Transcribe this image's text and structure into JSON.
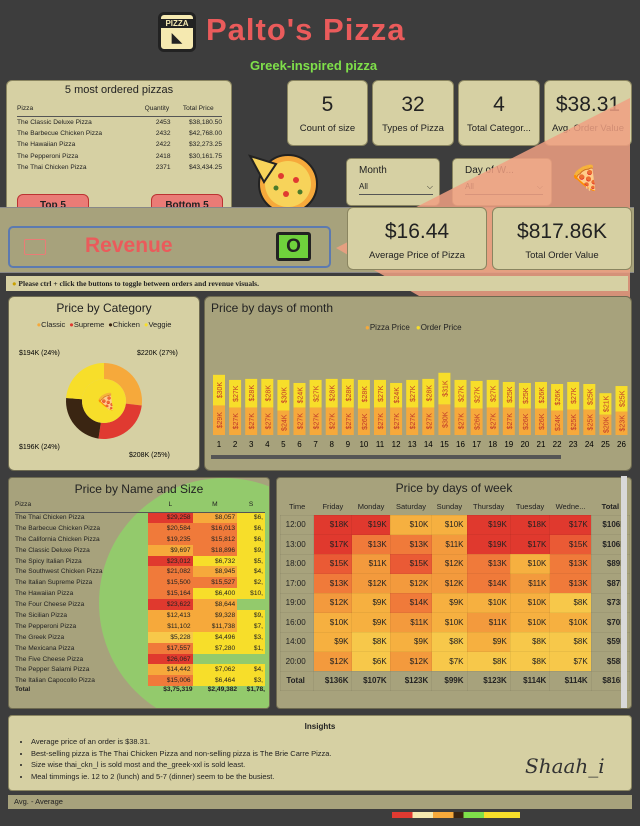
{
  "header": {
    "logo_text": "PIZZA",
    "title": "Palto's Pizza",
    "subtitle": "Greek-inspired pizza"
  },
  "top5": {
    "title": "5 most ordered pizzas",
    "col_pizza": "Pizza",
    "col_qty": "Quantity",
    "col_total": "Total Price",
    "rows": [
      {
        "name": "The Classic Deluxe Pizza",
        "qty": "2453",
        "total": "$38,180.50"
      },
      {
        "name": "The Barbecue Chicken Pizza",
        "qty": "2432",
        "total": "$42,768.00"
      },
      {
        "name": "The Hawaiian Pizza",
        "qty": "2422",
        "total": "$32,273.25"
      },
      {
        "name": "The Pepperoni Pizza",
        "qty": "2418",
        "total": "$30,161.75"
      },
      {
        "name": "The Thai Chicken Pizza",
        "qty": "2371",
        "total": "$43,434.25"
      }
    ],
    "btn_top": "Top 5",
    "btn_bottom": "Bottom 5"
  },
  "kpis": {
    "count_size": {
      "value": "5",
      "label": "Count of size"
    },
    "types": {
      "value": "32",
      "label": "Types of Pizza"
    },
    "categories": {
      "value": "4",
      "label": "Total Categor..."
    },
    "avg_order": {
      "value": "$38.31",
      "label": "Avg. Order Value"
    },
    "avg_price": {
      "value": "$16.44",
      "label": "Average Price of Pizza"
    },
    "total_order": {
      "value": "$817.86K",
      "label": "Total Order Value"
    }
  },
  "filters": {
    "month_label": "Month",
    "month_value": "All",
    "dow_label": "Day of W...",
    "dow_value": "All"
  },
  "toggle": {
    "label": "Revenue",
    "switch": "O"
  },
  "hint": "Please ctrl + click the buttons to toggle between orders and revenue visuals.",
  "colors": {
    "classic": "#f6a93b",
    "supreme": "#e03a31",
    "chicken": "#3a2512",
    "veggie": "#f7de2a",
    "bar_price": "#f6a93b",
    "bar_order": "#f7de2a",
    "accent_red": "#ea5b5b",
    "title_green": "#7fe04a"
  },
  "category_chart": {
    "title": "Price by Category",
    "legend": [
      "Classic",
      "Supreme",
      "Chicken",
      "Veggie"
    ],
    "labels": [
      "$194K (24%)",
      "$220K (27%)",
      "$196K (24%)",
      "$208K (25%)"
    ],
    "chart_data": {
      "type": "pie",
      "categories": [
        "Classic",
        "Supreme",
        "Chicken",
        "Veggie"
      ],
      "values": [
        220,
        208,
        196,
        194
      ]
    }
  },
  "day_month_chart": {
    "title": "Price by days of month",
    "legend": [
      "Pizza Price",
      "Order Price"
    ],
    "chart_data": {
      "type": "bar",
      "categories": [
        "1",
        "2",
        "3",
        "4",
        "5",
        "6",
        "7",
        "8",
        "9",
        "10",
        "11",
        "12",
        "13",
        "14",
        "15",
        "16",
        "17",
        "18",
        "19",
        "20",
        "21",
        "22",
        "23",
        "24",
        "25",
        "26"
      ],
      "series": [
        {
          "name": "Pizza Price",
          "values": [
            29,
            27,
            27,
            27,
            24,
            27,
            27,
            27,
            27,
            26,
            27,
            27,
            27,
            27,
            30,
            27,
            26,
            27,
            27,
            26,
            26,
            24,
            25,
            25,
            20,
            23
          ]
        },
        {
          "name": "Order Price",
          "values": [
            30,
            27,
            28,
            28,
            30,
            24,
            27,
            28,
            28,
            28,
            27,
            24,
            27,
            28,
            31,
            27,
            27,
            27,
            25,
            25,
            26,
            26,
            27,
            25,
            21,
            25
          ]
        }
      ],
      "top_labels": [
        "$30K",
        "$27K",
        "$28K",
        "$28K",
        "$30K",
        "$24K",
        "$27K",
        "$28K",
        "$28K",
        "$28K",
        "$27K",
        "$24K",
        "$27K",
        "$28K",
        "$31K",
        "$27K",
        "$27K",
        "$27K",
        "$25K",
        "$25K",
        "$26K",
        "$26K",
        "$27K",
        "$25K",
        "$21K",
        "$25K"
      ],
      "bottom_labels": [
        "$29K",
        "$27K",
        "$27K",
        "$27K",
        "$24K",
        "$27K",
        "$27K",
        "$27K",
        "$27K",
        "$26K",
        "$27K",
        "$27K",
        "$27K",
        "$27K",
        "$30K",
        "$27K",
        "$26K",
        "$27K",
        "$27K",
        "$26K",
        "$26K",
        "$24K",
        "$25K",
        "$25K",
        "$20K",
        "$23K"
      ]
    }
  },
  "name_size": {
    "title": "Price by Name and Size",
    "cols": [
      "Pizza",
      "L",
      "M",
      "S"
    ],
    "rows": [
      [
        "The Thai Chicken Pizza",
        "$29,258",
        "$8,057",
        "$6,"
      ],
      [
        "The Barbecue Chicken Pizza",
        "$20,584",
        "$16,013",
        "$6,"
      ],
      [
        "The California Chicken Pizza",
        "$19,235",
        "$15,812",
        "$6,"
      ],
      [
        "The Classic Deluxe Pizza",
        "$9,697",
        "$18,896",
        "$9,"
      ],
      [
        "The Spicy Italian Pizza",
        "$23,012",
        "$6,732",
        "$5,"
      ],
      [
        "The Southwest Chicken Pizza",
        "$21,082",
        "$8,945",
        "$4,"
      ],
      [
        "The Italian Supreme Pizza",
        "$15,500",
        "$15,527",
        "$2,"
      ],
      [
        "The Hawaiian Pizza",
        "$15,164",
        "$6,400",
        "$10,"
      ],
      [
        "The Four Cheese Pizza",
        "$23,622",
        "$8,644",
        ""
      ],
      [
        "The Sicilian Pizza",
        "$12,413",
        "$9,328",
        "$9,"
      ],
      [
        "The Pepperoni Pizza",
        "$11,102",
        "$11,738",
        "$7,"
      ],
      [
        "The Greek Pizza",
        "$5,228",
        "$4,496",
        "$3,"
      ],
      [
        "The Mexicana Pizza",
        "$17,557",
        "$7,280",
        "$1,"
      ],
      [
        "The Five Cheese Pizza",
        "$26,067",
        "",
        ""
      ],
      [
        "The Pepper Salami Pizza",
        "$14,442",
        "$7,062",
        "$4,"
      ],
      [
        "The Italian Capocollo Pizza",
        "$15,006",
        "$6,464",
        "$3,"
      ]
    ],
    "total": [
      "Total",
      "$3,75,319",
      "$2,49,382",
      "$1,78,"
    ]
  },
  "heatmap": {
    "title": "Price by days of week",
    "cols": [
      "Time",
      "Friday",
      "Monday",
      "Saturday",
      "Sunday",
      "Thursday",
      "Tuesday",
      "Wedne...",
      "Total"
    ],
    "rows": [
      [
        "12:00",
        "$18K",
        "$19K",
        "$10K",
        "$10K",
        "$19K",
        "$18K",
        "$17K",
        "$106K"
      ],
      [
        "13:00",
        "$17K",
        "$13K",
        "$13K",
        "$11K",
        "$19K",
        "$17K",
        "$15K",
        "$106K"
      ],
      [
        "18:00",
        "$15K",
        "$11K",
        "$15K",
        "$12K",
        "$13K",
        "$10K",
        "$13K",
        "$89K"
      ],
      [
        "17:00",
        "$13K",
        "$12K",
        "$12K",
        "$12K",
        "$14K",
        "$11K",
        "$13K",
        "$87K"
      ],
      [
        "19:00",
        "$12K",
        "$9K",
        "$14K",
        "$9K",
        "$10K",
        "$10K",
        "$8K",
        "$73K"
      ],
      [
        "16:00",
        "$10K",
        "$9K",
        "$11K",
        "$10K",
        "$11K",
        "$10K",
        "$10K",
        "$70K"
      ],
      [
        "14:00",
        "$9K",
        "$8K",
        "$9K",
        "$8K",
        "$9K",
        "$8K",
        "$8K",
        "$59K"
      ],
      [
        "20:00",
        "$12K",
        "$6K",
        "$12K",
        "$7K",
        "$8K",
        "$8K",
        "$7K",
        "$58K"
      ]
    ],
    "total": [
      "Total",
      "$136K",
      "$107K",
      "$123K",
      "$99K",
      "$123K",
      "$114K",
      "$114K",
      "$816K"
    ]
  },
  "insights": {
    "title": "Insights",
    "items": [
      "Average price of an order is $38.31.",
      "Best-selling pizza is The Thai Chicken Pizza and non-selling pizza is The Brie Carre Pizza.",
      "Size wise thai_ckn_l is sold most and the_greek-xxl is sold least.",
      "Meal timmings ie. 12 to 2 (lunch) and 5-7 (dinner) seem to be the busiest."
    ],
    "signature": "Shaah_i"
  },
  "footer": {
    "text": "Avg. - Average"
  }
}
